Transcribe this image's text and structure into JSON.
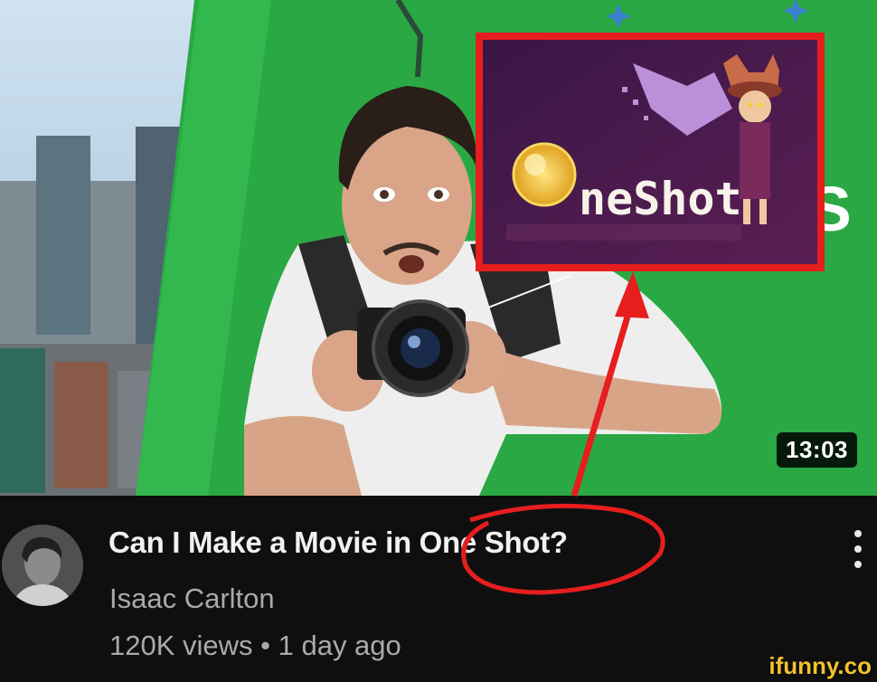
{
  "video": {
    "duration": "13:03",
    "title": "Can I Make a Movie in One Shot?",
    "channel": "Isaac Carlton",
    "stats": "120K views • 1 day ago"
  },
  "thumbnail_inset": {
    "logo_text": "neShot"
  },
  "watermark": "ifunny.co",
  "colors": {
    "background": "#0f0f0f",
    "greenscreen": "#2aa844",
    "annotation_red": "#e61e1e",
    "watermark": "#f2c22e"
  }
}
